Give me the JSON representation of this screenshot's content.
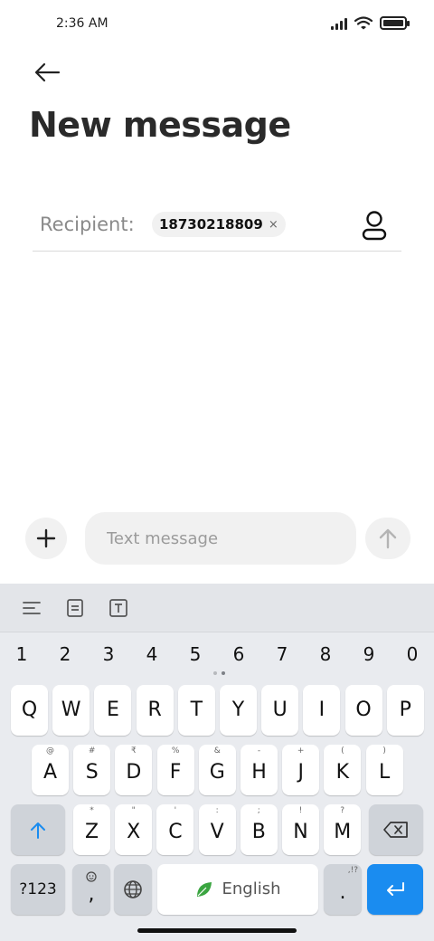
{
  "status_bar": {
    "time": "2:36 AM",
    "icons": [
      "signal-icon",
      "wifi-icon",
      "battery-icon"
    ]
  },
  "header": {
    "back_icon": "arrow-left-icon",
    "title": "New message"
  },
  "recipient": {
    "label": "Recipient:",
    "chips": [
      {
        "number": "18730218809",
        "remove_glyph": "×"
      }
    ],
    "contact_icon": "contact-person-icon"
  },
  "composer": {
    "attach_glyph": "+",
    "input_value": "",
    "input_placeholder": "Text message",
    "send_icon": "arrow-up-icon"
  },
  "keyboard": {
    "toolbar_icons": [
      "menu-lines-icon",
      "clipboard-icon",
      "text-format-icon"
    ],
    "number_row": [
      "1",
      "2",
      "3",
      "4",
      "5",
      "6",
      "7",
      "8",
      "9",
      "0"
    ],
    "row1": [
      {
        "main": "Q"
      },
      {
        "main": "W"
      },
      {
        "main": "E"
      },
      {
        "main": "R"
      },
      {
        "main": "T"
      },
      {
        "main": "Y"
      },
      {
        "main": "U"
      },
      {
        "main": "I"
      },
      {
        "main": "O"
      },
      {
        "main": "P"
      }
    ],
    "row2": [
      {
        "main": "A",
        "sup": "@"
      },
      {
        "main": "S",
        "sup": "#"
      },
      {
        "main": "D",
        "sup": "₹"
      },
      {
        "main": "F",
        "sup": "%"
      },
      {
        "main": "G",
        "sup": "&"
      },
      {
        "main": "H",
        "sup": "-"
      },
      {
        "main": "J",
        "sup": "+"
      },
      {
        "main": "K",
        "sup": "("
      },
      {
        "main": "L",
        "sup": ")"
      }
    ],
    "row3": [
      {
        "main": "Z",
        "sup": "*"
      },
      {
        "main": "X",
        "sup": "\""
      },
      {
        "main": "C",
        "sup": "'"
      },
      {
        "main": "V",
        "sup": ":"
      },
      {
        "main": "B",
        "sup": ";"
      },
      {
        "main": "N",
        "sup": "!"
      },
      {
        "main": "M",
        "sup": "?"
      }
    ],
    "shift_icon": "shift-arrow-icon",
    "backspace_icon": "backspace-icon",
    "symbols_label": "?123",
    "emoji_key": {
      "main": ",",
      "icon": "emoji-icon"
    },
    "globe_icon": "globe-icon",
    "space_label": "English",
    "space_icon": "leaf-icon",
    "period_key": {
      "main": ".",
      "sup": ",!?"
    },
    "enter_icon": "enter-arrow-icon",
    "colors": {
      "accent": "#1a8cf0",
      "leaf": "#3aa540"
    }
  }
}
